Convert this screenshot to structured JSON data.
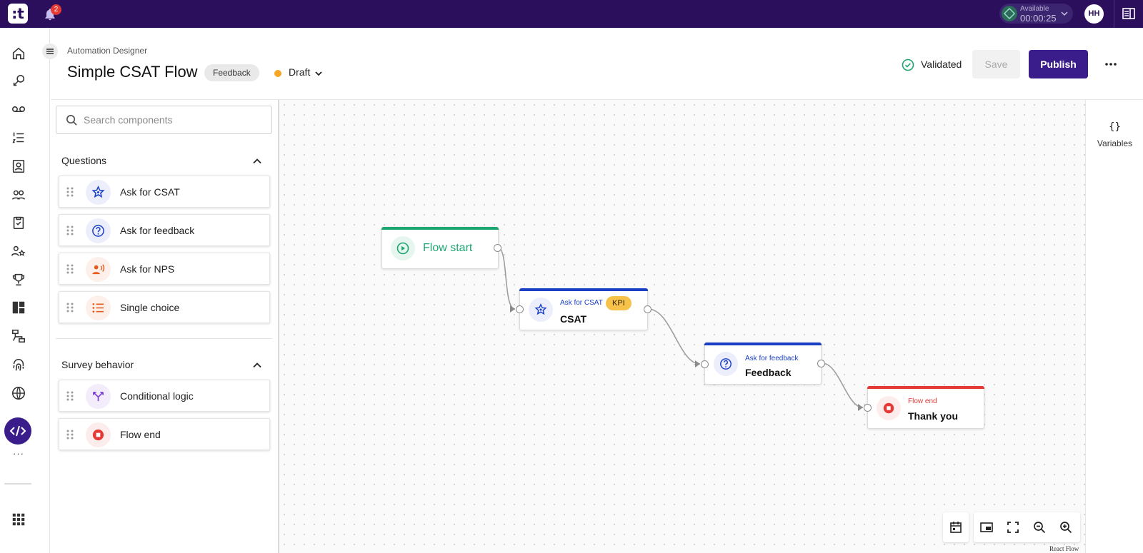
{
  "topbar": {
    "logo_glyph": ":t",
    "notification_count": "2",
    "status_label": "Available",
    "status_timer": "00:00:25",
    "avatar_initials": "HH"
  },
  "header": {
    "breadcrumb": "Automation Designer",
    "title": "Simple CSAT Flow",
    "tag": "Feedback",
    "state": "Draft",
    "validation": "Validated",
    "save_label": "Save",
    "publish_label": "Publish"
  },
  "panel": {
    "search_placeholder": "Search components",
    "sections": [
      {
        "title": "Questions",
        "items": [
          {
            "label": "Ask for CSAT",
            "icon": "star-icon"
          },
          {
            "label": "Ask for feedback",
            "icon": "question-circle-icon"
          },
          {
            "label": "Ask for NPS",
            "icon": "person-voice-icon"
          },
          {
            "label": "Single choice",
            "icon": "list-icon"
          }
        ]
      },
      {
        "title": "Survey behavior",
        "items": [
          {
            "label": "Conditional logic",
            "icon": "branch-icon"
          },
          {
            "label": "Flow end",
            "icon": "stop-circle-icon"
          }
        ]
      }
    ]
  },
  "flow": {
    "nodes": [
      {
        "id": "start",
        "label": "Flow start"
      },
      {
        "id": "csat",
        "kind": "Ask for CSAT",
        "name": "CSAT",
        "badge": "KPI"
      },
      {
        "id": "feedback",
        "kind": "Ask for feedback",
        "name": "Feedback"
      },
      {
        "id": "end",
        "kind": "Flow end",
        "name": "Thank you"
      }
    ]
  },
  "variables": {
    "label": "Variables",
    "icon": "{}"
  },
  "canvas": {
    "attribution": "React Flow"
  },
  "colors": {
    "brand": "#2b0f5c",
    "primary": "#3a1d8a",
    "start": "#1ea672",
    "question": "#1a3fc4",
    "end": "#e53935",
    "draft": "#f5a623",
    "kpi": "#f6c24a"
  }
}
